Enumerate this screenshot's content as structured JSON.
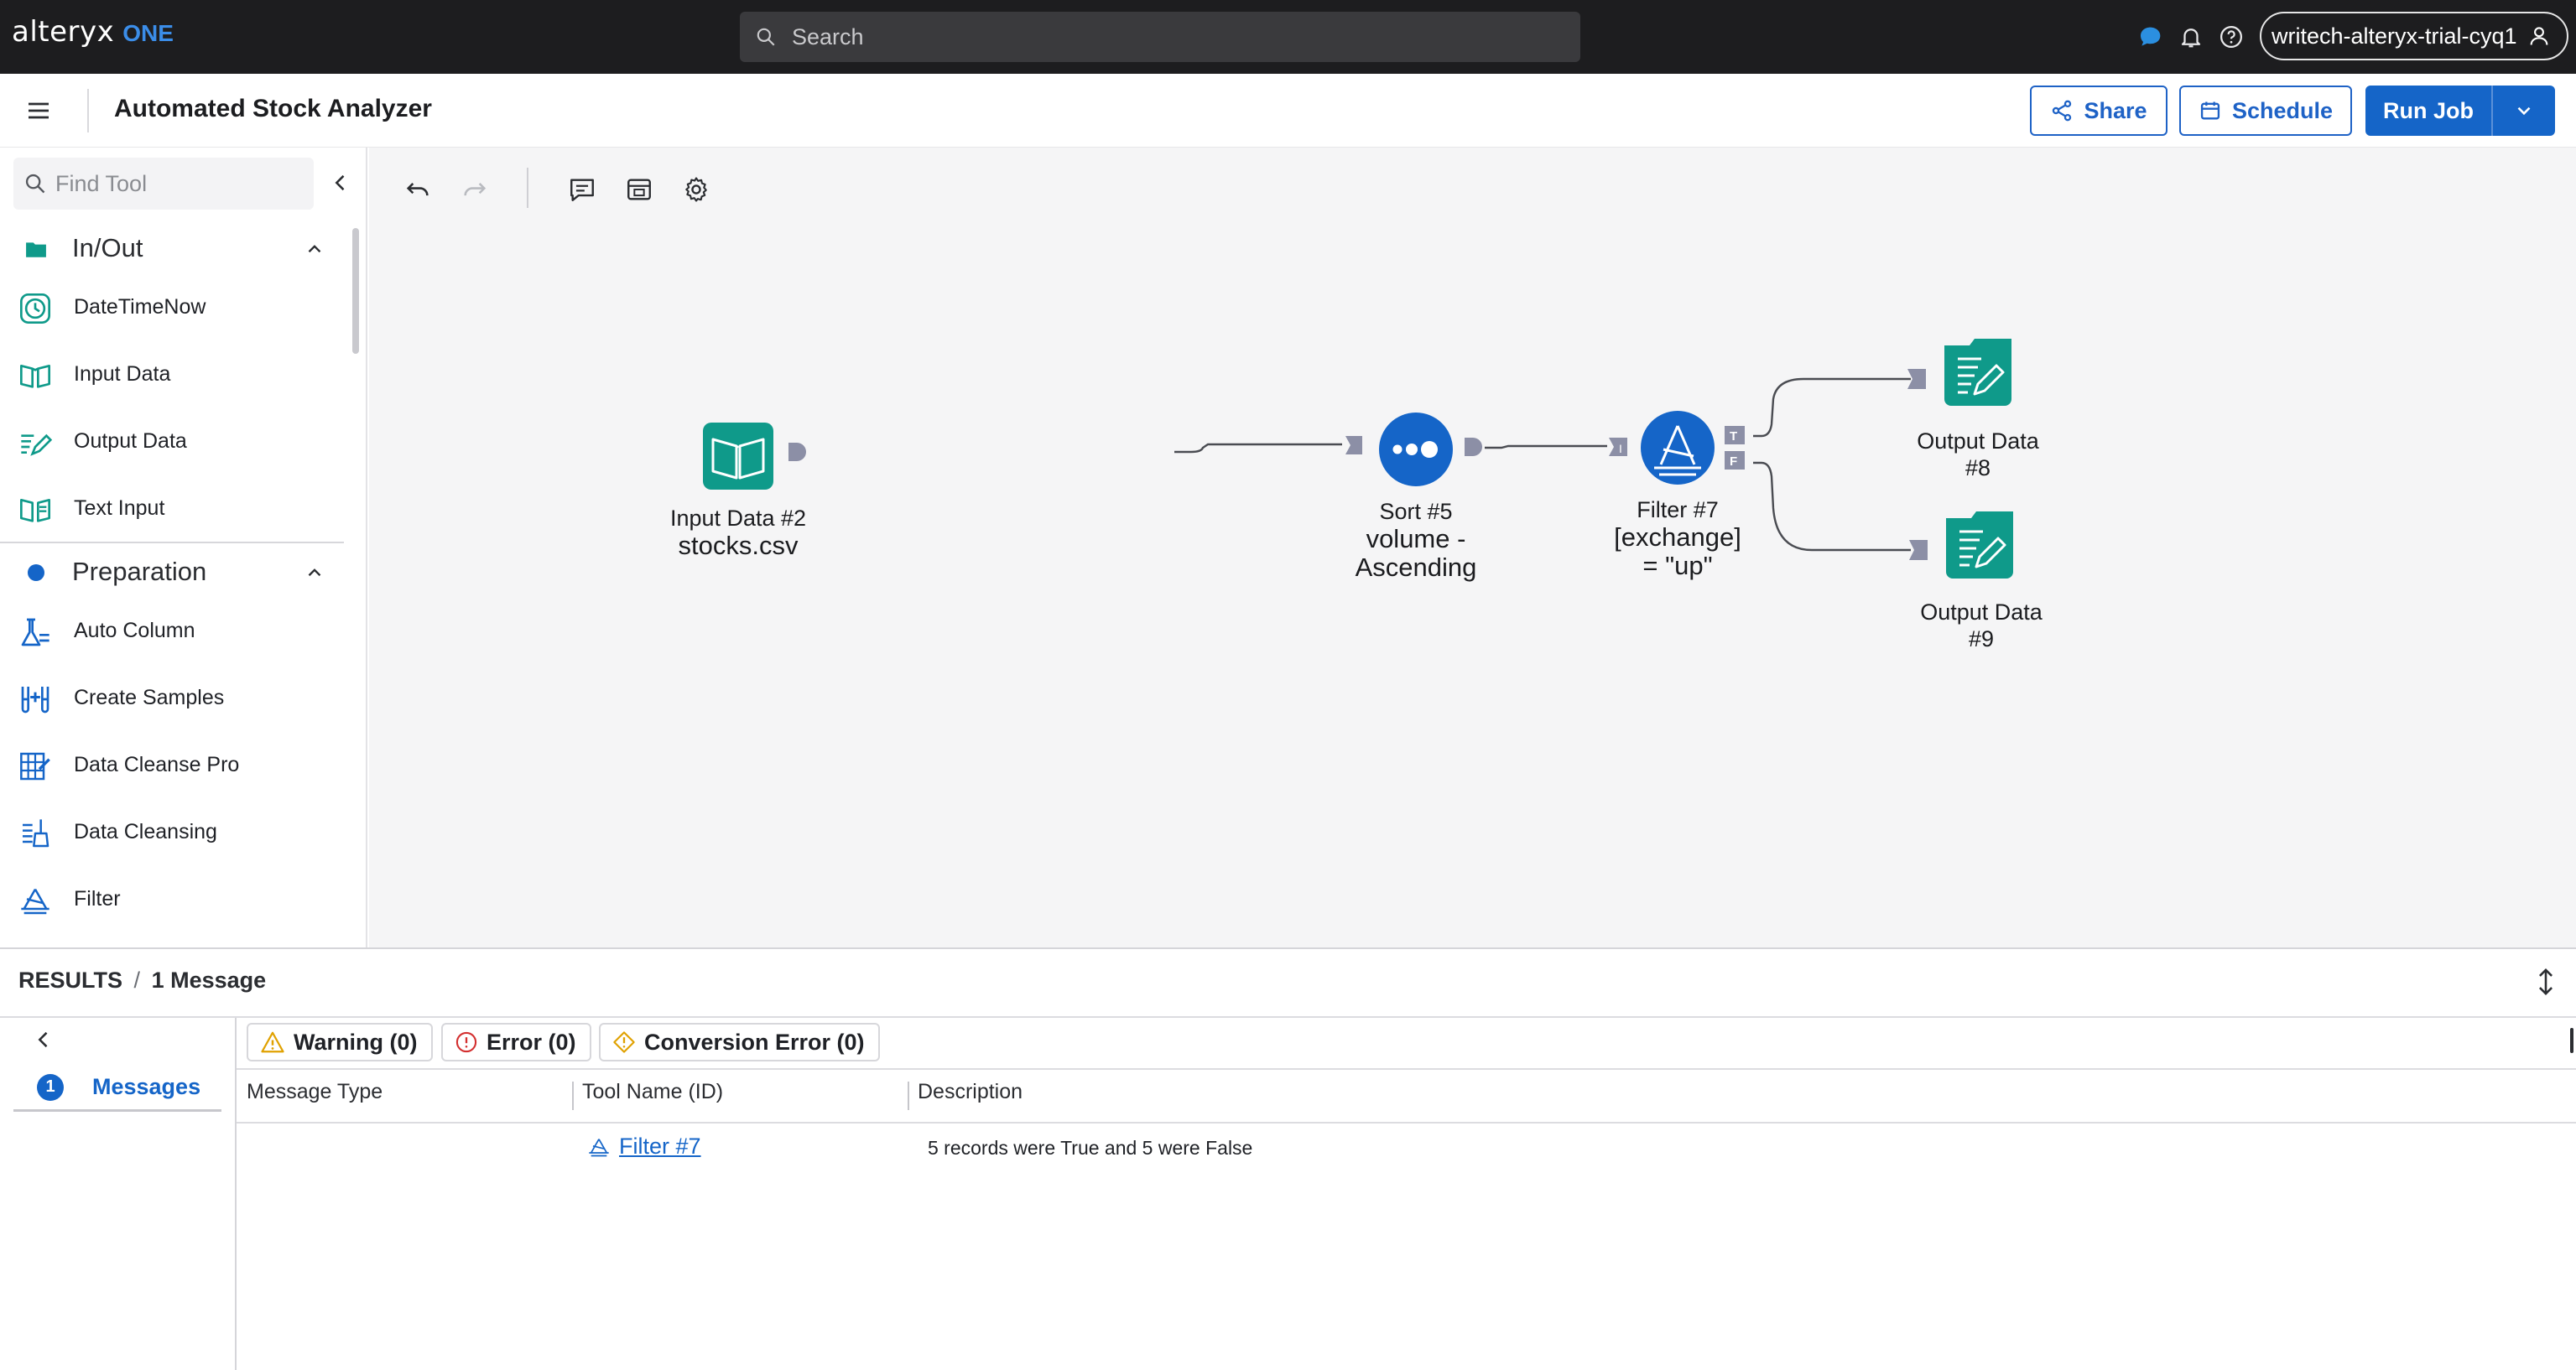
{
  "app": {
    "logo_word": "alteryx",
    "logo_suffix": "ONE"
  },
  "topbar": {
    "search_placeholder": "Search",
    "account_label": "writech-alteryx-trial-cyq1",
    "icons": [
      "chat-icon",
      "bell-icon",
      "help-icon",
      "user-icon"
    ]
  },
  "header": {
    "workflow_title": "Automated Stock Analyzer",
    "share_label": "Share",
    "schedule_label": "Schedule",
    "run_job_label": "Run Job"
  },
  "sidebar": {
    "find_tool_placeholder": "Find Tool",
    "categories": [
      {
        "label": "In/Out",
        "color": "#0f9a8a",
        "tools": [
          "DateTimeNow",
          "Input Data",
          "Output Data",
          "Text Input"
        ]
      },
      {
        "label": "Preparation",
        "color": "#1565c8",
        "tools": [
          "Auto Column",
          "Create Samples",
          "Data Cleanse Pro",
          "Data Cleansing",
          "Filter"
        ]
      }
    ]
  },
  "canvas": {
    "nodes": {
      "input": {
        "title": "Input Data #2",
        "sub": "stocks.csv"
      },
      "sort": {
        "title": "Sort #5",
        "sub1": "volume -",
        "sub2": "Ascending"
      },
      "filter": {
        "title": "Filter #7",
        "sub1": "[exchange]",
        "sub2": "= \"up\""
      },
      "out8": {
        "title1": "Output Data",
        "title2": "#8"
      },
      "out9": {
        "title1": "Output Data",
        "title2": "#9"
      }
    },
    "anchor_labels": {
      "true": "T",
      "false": "F",
      "input": "I"
    }
  },
  "results": {
    "header_prefix": "RESULTS",
    "header_sep": "/",
    "header_count": "1 Message",
    "nav_badge": "1",
    "nav_label": "Messages",
    "chips": {
      "warning": "Warning (0)",
      "error": "Error (0)",
      "conversion": "Conversion Error (0)"
    },
    "columns": [
      "Message Type",
      "Tool Name (ID)",
      "Description"
    ],
    "rows": [
      {
        "type": "",
        "tool": "Filter #7",
        "description": "5 records were True and 5 were False"
      }
    ]
  },
  "colors": {
    "teal": "#0f9a8a",
    "blue": "#1565c8",
    "dark": "#1d1d1f",
    "accent": "#1e62c6"
  }
}
